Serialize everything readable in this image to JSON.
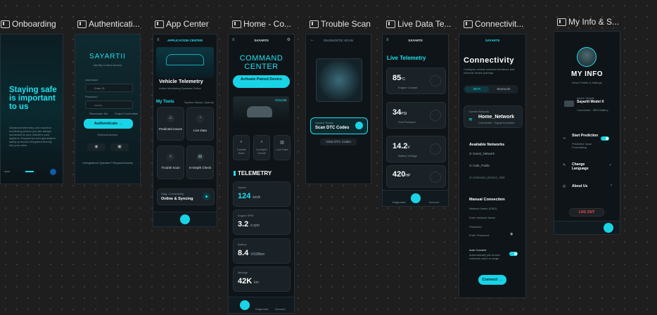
{
  "frames": [
    {
      "title": "Onboarding"
    },
    {
      "title": "Authenticati..."
    },
    {
      "title": "App Center"
    },
    {
      "title": "Home - Co..."
    },
    {
      "title": "Trouble Scan"
    },
    {
      "title": "Live Data Te..."
    },
    {
      "title": "Connectivit..."
    },
    {
      "title": "My Info & S..."
    }
  ],
  "onboarding": {
    "headline": "Staying safe is important to us",
    "body": "Advanced telemetry and real-time monitoring ensure you are always connected to your vehicle's core systems. Experience next-generation safety protocols integrated directly into your drive."
  },
  "auth": {
    "brand": "SAYARTII",
    "subtitle": "Identity Control Access",
    "field1_label": "Username",
    "field1_ph": "Enter ID",
    "field2_label": "Password",
    "field2_ph": "••••••••",
    "remember": "Remember Me",
    "forgot": "Forgot Credentials",
    "cta": "Authenticate →",
    "divider": "External Access",
    "footer": "Unregistered Operator? Request Access"
  },
  "appcenter": {
    "header": "APPLICATION CENTER",
    "hero_title": "Vehicle Telemetry",
    "hero_sub": "Active Monitoring Systems Online",
    "section": "My Tools",
    "section_right": "System Status: Optimal",
    "tools": [
      "Predicted Issues",
      "Live Data",
      "Trouble Scan",
      "In-Depth Check"
    ],
    "status_label": "Diag. Connectivity",
    "status_value": "Online & Syncing"
  },
  "home": {
    "header": "SAYARTII",
    "title": "COMMAND CENTER",
    "cta": "Activate Paired Device",
    "online": "ONLINE",
    "actions": [
      "Trouble Scan",
      "In-Depth Check",
      "Live Data"
    ],
    "telemetry_title": "TELEMETRY",
    "metrics": [
      {
        "label": "Speed",
        "value": "124",
        "unit": "km/h"
      },
      {
        "label": "Engine RPM",
        "value": "3.2",
        "unit": "k rpm"
      },
      {
        "label": "Battery",
        "value": "8.4",
        "unit": "V/100km"
      },
      {
        "label": "Mileage",
        "value": "42K",
        "unit": "km"
      }
    ],
    "nav": [
      "Home",
      "Diagnostic",
      "Account"
    ]
  },
  "scan": {
    "header": "DIAGNOSTIC SCAN",
    "panel_label": "System Ready",
    "cta": "Scan DTC Codes",
    "secondary": "Clear DTC Codes"
  },
  "live": {
    "header": "SAYARTII",
    "title": "Live Telemetry",
    "readings": [
      {
        "value": "85",
        "unit": "°C",
        "label": "Engine Coolant"
      },
      {
        "value": "34",
        "unit": "PSI",
        "label": "Fuel Pressure"
      },
      {
        "value": "14.2",
        "unit": "V",
        "label": "Battery Voltage"
      },
      {
        "value": "420",
        "unit": "HP",
        "label": "Power Output"
      }
    ],
    "nav": [
      "Diagnostic",
      "Home",
      "Account"
    ]
  },
  "conn": {
    "header": "SAYARTII",
    "title": "Connectivity",
    "subtitle": "Configure vehicle network interfaces and external device pairings.",
    "tab_wifi": "Wi-Fi",
    "tab_bt": "Bluetooth",
    "current_label": "Current Network",
    "current": "Home_Network",
    "current_status": "Connected · Signal Excellent",
    "available_title": "Available Networks",
    "networks": [
      "Guest_Network",
      "Cafe_Public",
      "Unknown_Device_X50"
    ],
    "manual_title": "Manual Connection",
    "ssid_label": "Network Name (SSID)",
    "ssid_ph": "Enter Network Name",
    "pw_label": "Password",
    "pw_ph": "Enter Password",
    "auto_title": "Auto Connect",
    "auto_desc": "Automatically join known networks when in range",
    "cta": "Connect →"
  },
  "myinfo": {
    "title": "MY INFO",
    "subtitle": "Driver Profile & Settings",
    "vehicle_label": "Active Vehicle",
    "vehicle_name": "Sayartii Model X",
    "vehicle_status": "Connected · 98% Battery",
    "settings": [
      {
        "label": "Start Prediction",
        "desc": "Predictive Issue Forecasting"
      },
      {
        "label": "Change Language"
      },
      {
        "label": "About Us"
      }
    ],
    "logout": "LOG OUT"
  }
}
